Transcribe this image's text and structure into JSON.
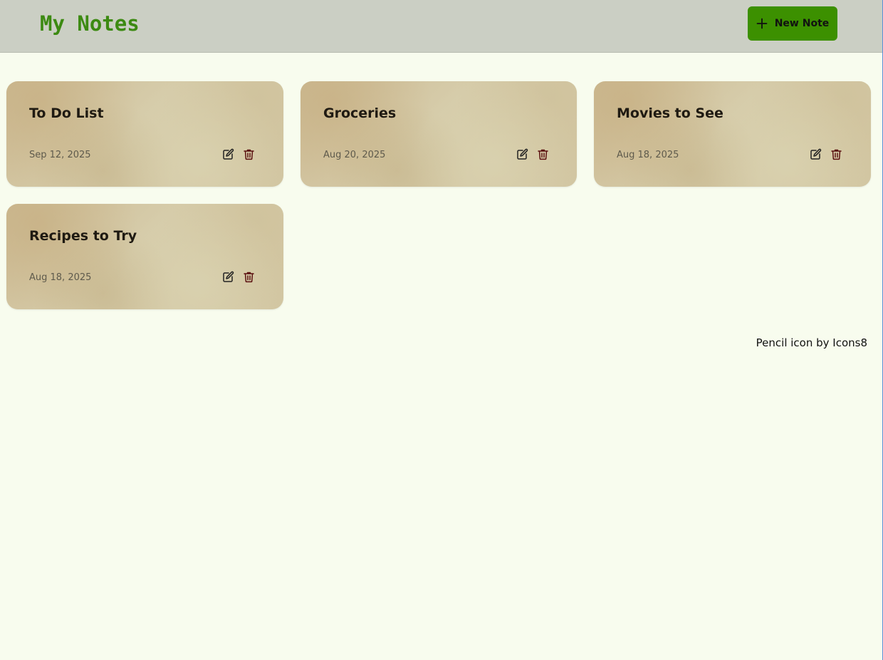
{
  "header": {
    "title": "My Notes",
    "new_note_label": "New Note",
    "accent_color": "#3c9000"
  },
  "notes": [
    {
      "title": "To Do List",
      "date": "Sep 12, 2025"
    },
    {
      "title": "Groceries",
      "date": "Aug 20, 2025"
    },
    {
      "title": "Movies to See",
      "date": "Aug 18, 2025"
    },
    {
      "title": "Recipes to Try",
      "date": "Aug 18, 2025"
    }
  ],
  "icons": {
    "edit": "pencil-edit-icon",
    "delete": "trash-icon",
    "add": "plus-icon"
  },
  "footer": {
    "credit": "Pencil icon by Icons8"
  }
}
